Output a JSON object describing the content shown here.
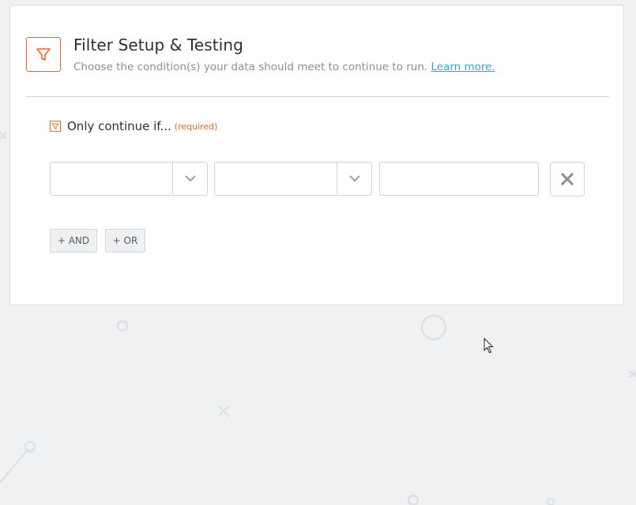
{
  "header": {
    "title": "Filter Setup & Testing",
    "subtitle": "Choose the condition(s) your data should meet to continue to run.",
    "learn_more": "Learn more."
  },
  "condition": {
    "label": "Only continue if...",
    "required": "(required)",
    "field_value": "",
    "operator_value": "",
    "value_input": ""
  },
  "buttons": {
    "and_label": "+ AND",
    "or_label": "+ OR"
  },
  "colors": {
    "accent": "#e8652b",
    "link": "#3aa0d6",
    "background": "#eff1f2"
  },
  "icons": {
    "header": "filter-icon",
    "condition": "filter-icon",
    "select_arrow": "chevron-down-icon",
    "remove": "close-icon"
  }
}
